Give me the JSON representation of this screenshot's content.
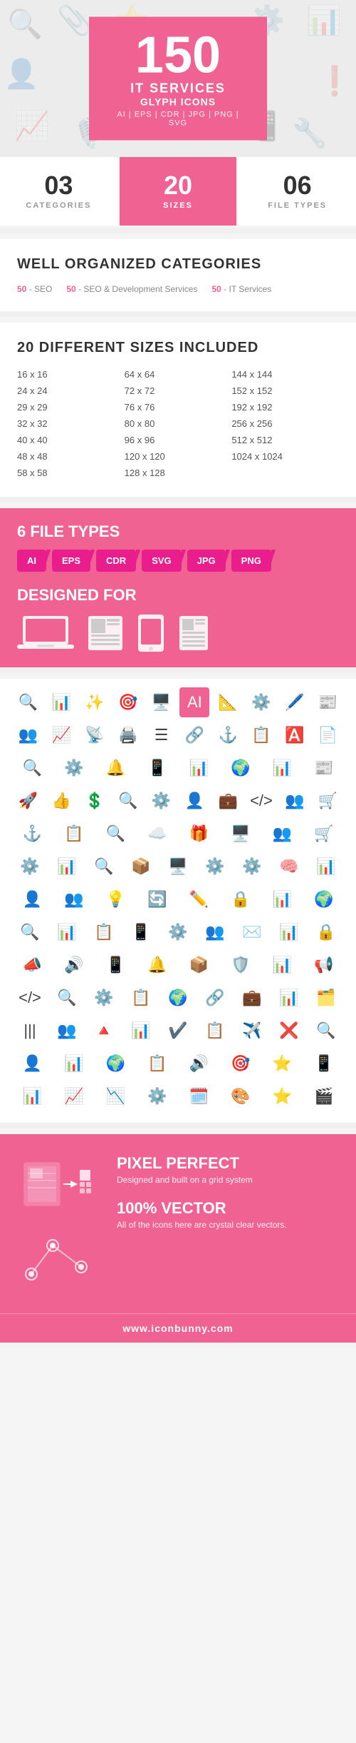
{
  "hero": {
    "number": "150",
    "line1": "IT SERVICES",
    "line2": "GLYPH ICONS",
    "formats": "AI  |  EPS  |  CDR  |  JPG  |  PNG  |  SVG"
  },
  "stats": [
    {
      "number": "03",
      "label": "CATEGORIES",
      "active": false
    },
    {
      "number": "20",
      "label": "SIZES",
      "active": true
    },
    {
      "number": "06",
      "label": "FILE TYPES",
      "active": false
    }
  ],
  "categories": {
    "title": "WELL ORGANIZED CATEGORIES",
    "items": [
      {
        "count": "50",
        "name": "SEO"
      },
      {
        "count": "50",
        "name": "SEO & Development Services"
      },
      {
        "count": "50",
        "name": "IT Services"
      }
    ]
  },
  "sizes": {
    "title": "20 DIFFERENT SIZES INCLUDED",
    "list": [
      "16 x 16",
      "64 x 64",
      "144 x 144",
      "24 x 24",
      "72 x 72",
      "152 x 152",
      "29 x 29",
      "76 x 76",
      "192 x 192",
      "32 x 32",
      "80 x 80",
      "256 x 256",
      "40 x 40",
      "96 x 96",
      "512 x 512",
      "48 x 48",
      "120 x 120",
      "1024 x 1024",
      "58 x 58",
      "128 x 128",
      ""
    ]
  },
  "fileTypes": {
    "title": "6 FILE TYPES",
    "badges": [
      "AI",
      "EPS",
      "CDR",
      "SVG",
      "JPG",
      "PNG"
    ],
    "designedFor": "DESIGNED FOR"
  },
  "bottom": {
    "feature1_title": "PIXEL PERFECT",
    "feature1_desc": "Designed and built\non a grid system",
    "feature2_title": "100% VECTOR",
    "feature2_desc": "All of the icons here are\ncrystal clear vectors."
  },
  "footer": {
    "url": "www.iconbunny.com"
  },
  "colors": {
    "pink": "#f06292",
    "dark_pink": "#e91e8c"
  }
}
